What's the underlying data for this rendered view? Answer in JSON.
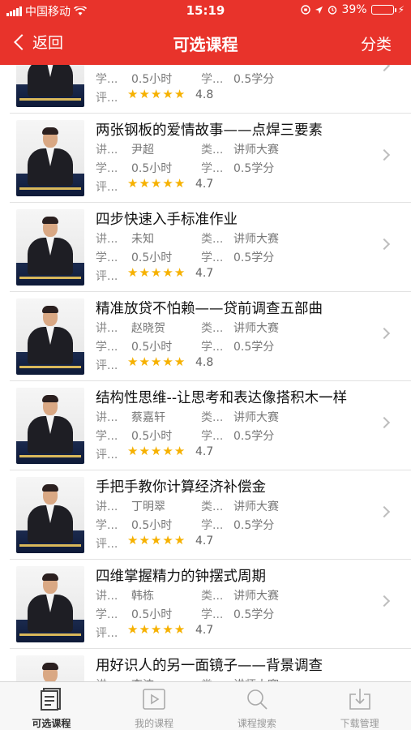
{
  "status_bar": {
    "carrier": "中国移动",
    "time": "15:19",
    "battery": "39%",
    "battery_level": 0.39
  },
  "header": {
    "back_label": "返回",
    "title": "可选课程",
    "right_label": "分类"
  },
  "courses": [
    {
      "title": "",
      "lecturer_label": "",
      "lecturer": "",
      "type_label": "",
      "type": "",
      "hours_label": "学...",
      "hours": "0.5小时",
      "credit_label": "学...",
      "credit": "0.5学分",
      "rating_label": "评...",
      "rating": "4.8",
      "stars": 5
    },
    {
      "title": "两张钢板的爱情故事——点焊三要素",
      "lecturer_label": "讲...",
      "lecturer": "尹超",
      "type_label": "类...",
      "type": "讲师大赛",
      "hours_label": "学...",
      "hours": "0.5小时",
      "credit_label": "学...",
      "credit": "0.5学分",
      "rating_label": "评...",
      "rating": "4.7",
      "stars": 5
    },
    {
      "title": "四步快速入手标准作业",
      "lecturer_label": "讲...",
      "lecturer": "未知",
      "type_label": "类...",
      "type": "讲师大赛",
      "hours_label": "学...",
      "hours": "0.5小时",
      "credit_label": "学...",
      "credit": "0.5学分",
      "rating_label": "评...",
      "rating": "4.7",
      "stars": 5
    },
    {
      "title": "精准放贷不怕赖——贷前调查五部曲",
      "lecturer_label": "讲...",
      "lecturer": "赵晓贺",
      "type_label": "类...",
      "type": "讲师大赛",
      "hours_label": "学...",
      "hours": "0.5小时",
      "credit_label": "学...",
      "credit": "0.5学分",
      "rating_label": "评...",
      "rating": "4.8",
      "stars": 5
    },
    {
      "title": "结构性思维--让思考和表达像搭积木一样",
      "lecturer_label": "讲...",
      "lecturer": "蔡嘉轩",
      "type_label": "类...",
      "type": "讲师大赛",
      "hours_label": "学...",
      "hours": "0.5小时",
      "credit_label": "学...",
      "credit": "0.5学分",
      "rating_label": "评...",
      "rating": "4.7",
      "stars": 5
    },
    {
      "title": "手把手教你计算经济补偿金",
      "lecturer_label": "讲...",
      "lecturer": "丁明翠",
      "type_label": "类...",
      "type": "讲师大赛",
      "hours_label": "学...",
      "hours": "0.5小时",
      "credit_label": "学...",
      "credit": "0.5学分",
      "rating_label": "评...",
      "rating": "4.7",
      "stars": 5
    },
    {
      "title": "四维掌握精力的钟摆式周期",
      "lecturer_label": "讲...",
      "lecturer": "韩栋",
      "type_label": "类...",
      "type": "讲师大赛",
      "hours_label": "学...",
      "hours": "0.5小时",
      "credit_label": "学...",
      "credit": "0.5学分",
      "rating_label": "评...",
      "rating": "4.7",
      "stars": 5
    },
    {
      "title": "用好识人的另一面镜子——背景调查",
      "lecturer_label": "讲...",
      "lecturer": "李洁",
      "type_label": "类...",
      "type": "讲师大赛",
      "hours_label": "",
      "hours": "",
      "credit_label": "",
      "credit": "",
      "rating_label": "",
      "rating": "",
      "stars": 0
    }
  ],
  "tabs": [
    {
      "label": "可选课程",
      "icon": "book-list-icon",
      "active": true
    },
    {
      "label": "我的课程",
      "icon": "play-icon",
      "active": false
    },
    {
      "label": "课程搜索",
      "icon": "search-icon",
      "active": false
    },
    {
      "label": "下载管理",
      "icon": "download-icon",
      "active": false
    }
  ],
  "colors": {
    "header_bg": "#e8332b",
    "star": "#f6b100",
    "battery_fill": "#4cd964"
  }
}
